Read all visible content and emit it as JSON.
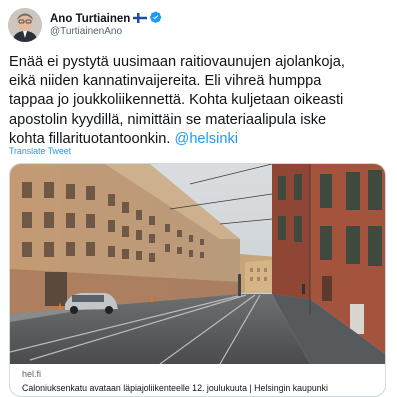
{
  "author": {
    "display_name": "Ano Turtiainen",
    "handle": "@TurtiainenAno",
    "flag_icon": "finland-flag-icon",
    "verified_icon": "verified-badge-icon",
    "verified_color": "#1d9bf0"
  },
  "tweet": {
    "lines": [
      "Enää ei pystytä uusimaan raitiovaunujen ajolankoja,",
      "eikä niiden kannatinvaijereita. Eli vihreä humppa",
      "tappaa jo joukkoliikennettä. Kohta kuljetaan oikeasti",
      "apostolin kyydillä, nimittäin se materiaalipula iske"
    ],
    "last_line_text": "kohta fillarituotantoonkin. ",
    "mention": "@helsinki",
    "translate_label": "Translate Tweet"
  },
  "link_card": {
    "domain": "hel.fi",
    "title": "Caloniuksenkatu avataan läpiajoliikenteelle 12. joulukuuta | Helsingin kaupunki",
    "image_description_icon": "street-photo-image"
  },
  "colors": {
    "link": "#1d9bf0",
    "text": "#0f1419",
    "secondary": "#536471",
    "border": "#cfd9de"
  }
}
